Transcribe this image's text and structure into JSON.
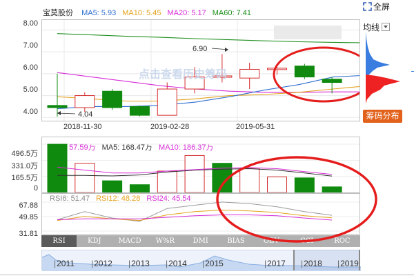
{
  "header": {
    "stock_name": "宝莫股份",
    "ma": [
      {
        "label": "MA5: 5.93",
        "color": "#2f6fd0"
      },
      {
        "label": "MA10: 5.45",
        "color": "#e3a21b"
      },
      {
        "label": "MA20: 5.17",
        "color": "#d62cd6"
      },
      {
        "label": "MA60: 7.41",
        "color": "#1f8f1f"
      }
    ]
  },
  "controls": {
    "fullscreen_label": "全屏",
    "ma_select_label": "均线",
    "chip_label": "筹码分布"
  },
  "price_chart": {
    "y_ticks": [
      "8.00",
      "7.00",
      "6.00",
      "5.00",
      "4.00"
    ],
    "x_ticks": [
      "2018-11-30",
      "2019-02-28",
      "2019-05-31"
    ],
    "high_annotation": "6.90",
    "low_annotation": "4.04",
    "watermark": "点击查看历史筹码"
  },
  "volume_chart": {
    "legend": [
      {
        "label": "VOL: 57.59万",
        "color": "#d62cd6"
      },
      {
        "label": "MA5: 168.47万",
        "color": "#333333"
      },
      {
        "label": "MA10: 186.37万",
        "color": "#d62cd6"
      }
    ],
    "y_ticks": [
      "496.5万",
      "331.0万",
      "165.5万",
      "0"
    ]
  },
  "rsi_chart": {
    "legend": [
      {
        "label": "RSI6: 51.47",
        "color": "#888888"
      },
      {
        "label": "RSI12: 48.28",
        "color": "#e3a21b"
      },
      {
        "label": "RSI24: 45.54",
        "color": "#d62cd6"
      }
    ],
    "y_ticks": [
      "67.88",
      "49.85",
      "31.81"
    ]
  },
  "indicator_tabs": [
    "RSI",
    "KDJ",
    "MACD",
    "W%R",
    "DMI",
    "BIAS",
    "OBV",
    "CCI",
    "ROC"
  ],
  "timeline_years": [
    "2011",
    "2012",
    "2013",
    "2014",
    "2015",
    "2017",
    "2018",
    "2019"
  ],
  "colors": {
    "up": "#d42a2a",
    "down": "#0f8a0f",
    "annotation_red": "#e51c1c",
    "chip_orange": "#e2621c",
    "chip_blue": "#3a7de0"
  },
  "chart_data": {
    "type": "candlestick",
    "x_ticks": [
      "2018-11-30",
      "2019-02-28",
      "2019-05-31"
    ],
    "ylim": [
      3.6,
      8.2
    ],
    "candles": [
      {
        "o": 4.55,
        "h": 6.0,
        "l": 4.04,
        "c": 4.45
      },
      {
        "o": 4.45,
        "h": 5.15,
        "l": 4.25,
        "c": 5.0
      },
      {
        "o": 5.2,
        "h": 5.3,
        "l": 4.35,
        "c": 4.45
      },
      {
        "o": 4.5,
        "h": 4.55,
        "l": 4.05,
        "c": 4.1
      },
      {
        "o": 4.1,
        "h": 5.6,
        "l": 4.1,
        "c": 5.3
      },
      {
        "o": 5.3,
        "h": 6.3,
        "l": 5.1,
        "c": 5.85
      },
      {
        "o": 5.9,
        "h": 6.9,
        "l": 5.6,
        "c": 5.9
      },
      {
        "o": 5.8,
        "h": 6.5,
        "l": 5.3,
        "c": 6.2
      },
      {
        "o": 6.2,
        "h": 6.3,
        "l": 5.95,
        "c": 6.25
      },
      {
        "o": 6.35,
        "h": 6.45,
        "l": 5.75,
        "c": 5.85
      },
      {
        "o": 5.75,
        "h": 5.85,
        "l": 5.1,
        "c": 5.6
      }
    ],
    "ma_series": [
      {
        "name": "MA60",
        "color": "#1f8f1f",
        "values": [
          7.83,
          7.77,
          7.71,
          7.66,
          7.6,
          7.55,
          7.5,
          7.46,
          7.43,
          7.41
        ]
      },
      {
        "name": "MA20",
        "color": "#d62cd6",
        "values": [
          6.05,
          5.85,
          5.65,
          5.45,
          5.3,
          5.2,
          5.15,
          5.15,
          5.17,
          5.17
        ]
      },
      {
        "name": "MA10",
        "color": "#e3a21b",
        "values": [
          4.95,
          4.85,
          4.75,
          4.75,
          4.85,
          5.0,
          5.05,
          5.15,
          5.3,
          5.45
        ]
      },
      {
        "name": "MA5",
        "color": "#2f6fd0",
        "values": [
          4.4,
          4.5,
          4.5,
          4.55,
          4.7,
          4.95,
          5.25,
          5.5,
          5.85,
          5.93
        ]
      }
    ],
    "volume": {
      "ylim": [
        0,
        496.5
      ],
      "bars": [
        {
          "v": 496,
          "up": false
        },
        {
          "v": 300,
          "up": true
        },
        {
          "v": 120,
          "up": false
        },
        {
          "v": 80,
          "up": false
        },
        {
          "v": 220,
          "up": true
        },
        {
          "v": 380,
          "up": true
        },
        {
          "v": 300,
          "up": false
        },
        {
          "v": 250,
          "up": true
        },
        {
          "v": 160,
          "up": true
        },
        {
          "v": 150,
          "up": false
        },
        {
          "v": 57.59,
          "up": false
        }
      ],
      "ma5": [
        175,
        175,
        170,
        180,
        210,
        230,
        240,
        245,
        230,
        200,
        168.47
      ],
      "ma10": [
        260,
        230,
        200,
        200,
        220,
        235,
        250,
        255,
        245,
        215,
        186.37
      ]
    },
    "rsi": {
      "ylim": [
        31.81,
        67.88
      ],
      "rsi6": [
        46,
        56,
        48,
        44,
        60,
        64,
        68,
        66,
        62,
        56,
        51.47
      ],
      "rsi12": [
        45,
        50,
        47,
        45,
        52,
        56,
        58,
        57,
        55,
        51,
        48.28
      ],
      "rsi24": [
        46,
        47,
        47,
        47,
        49,
        51,
        52,
        52,
        51,
        48,
        45.54
      ]
    }
  }
}
